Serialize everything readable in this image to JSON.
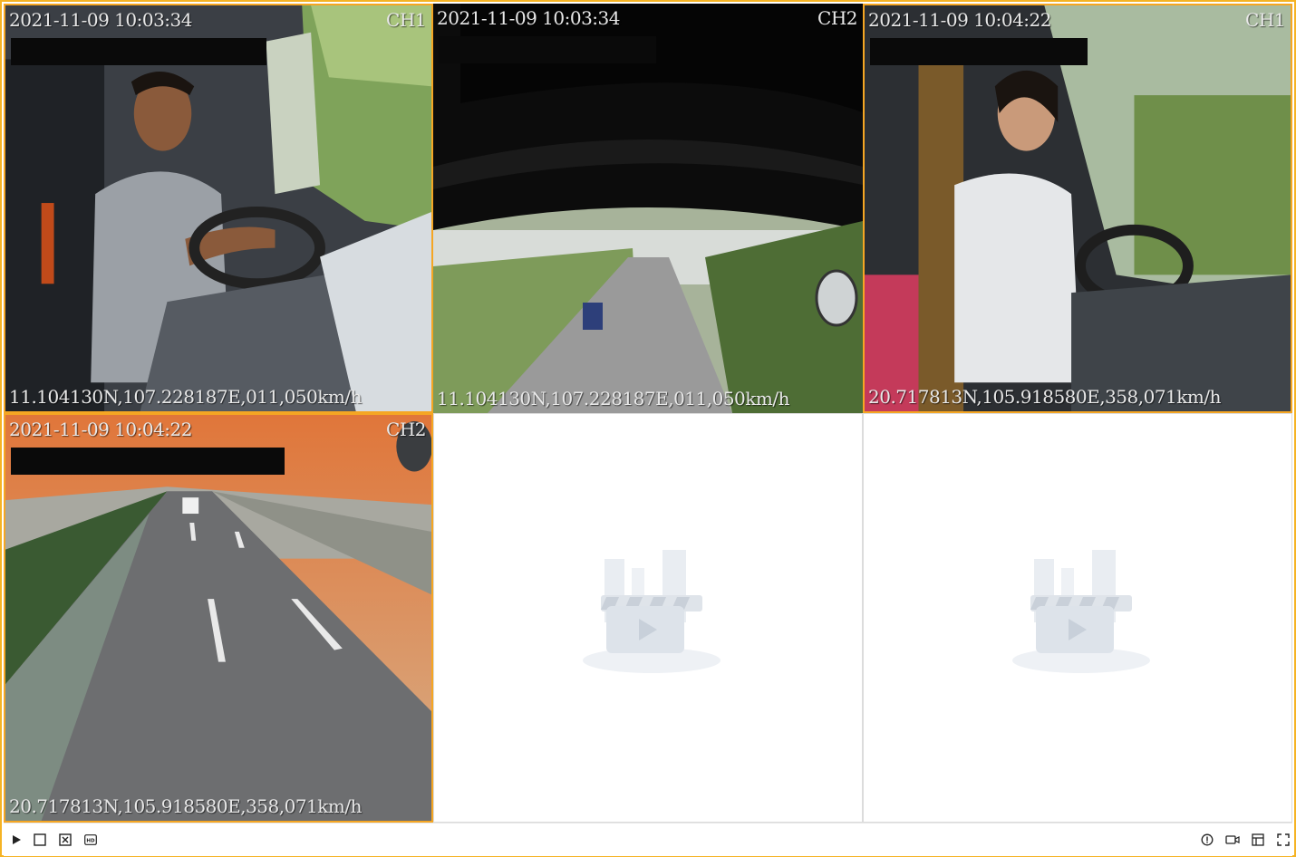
{
  "colors": {
    "accent": "#f5b324",
    "active_border": "#f5a623",
    "osd_text": "#e8e8e8"
  },
  "cells": [
    {
      "timestamp": "2021-11-09 10:03:34",
      "channel": "CH1",
      "gps": "11.104130N,107.228187E,011,050km/h",
      "state": "active"
    },
    {
      "timestamp": "2021-11-09 10:03:34",
      "channel": "CH2",
      "gps": "11.104130N,107.228187E,011,050km/h",
      "state": "playing"
    },
    {
      "timestamp": "2021-11-09 10:04:22",
      "channel": "CH1",
      "gps": "20.717813N,105.918580E,358,071km/h",
      "state": "active"
    },
    {
      "timestamp": "2021-11-09 10:04:22",
      "channel": "CH2",
      "gps": "20.717813N,105.918580E,358,071km/h",
      "state": "selected"
    },
    {
      "state": "empty",
      "icon": "video-placeholder-icon"
    },
    {
      "state": "empty",
      "icon": "video-placeholder-icon"
    }
  ],
  "toolbar": {
    "left_icons": [
      "play-icon",
      "stop-icon",
      "close-all-icon",
      "hd-icon"
    ],
    "right_icons": [
      "info-icon",
      "record-icon",
      "layout-icon",
      "fullscreen-icon"
    ],
    "hd_label": "HD"
  }
}
